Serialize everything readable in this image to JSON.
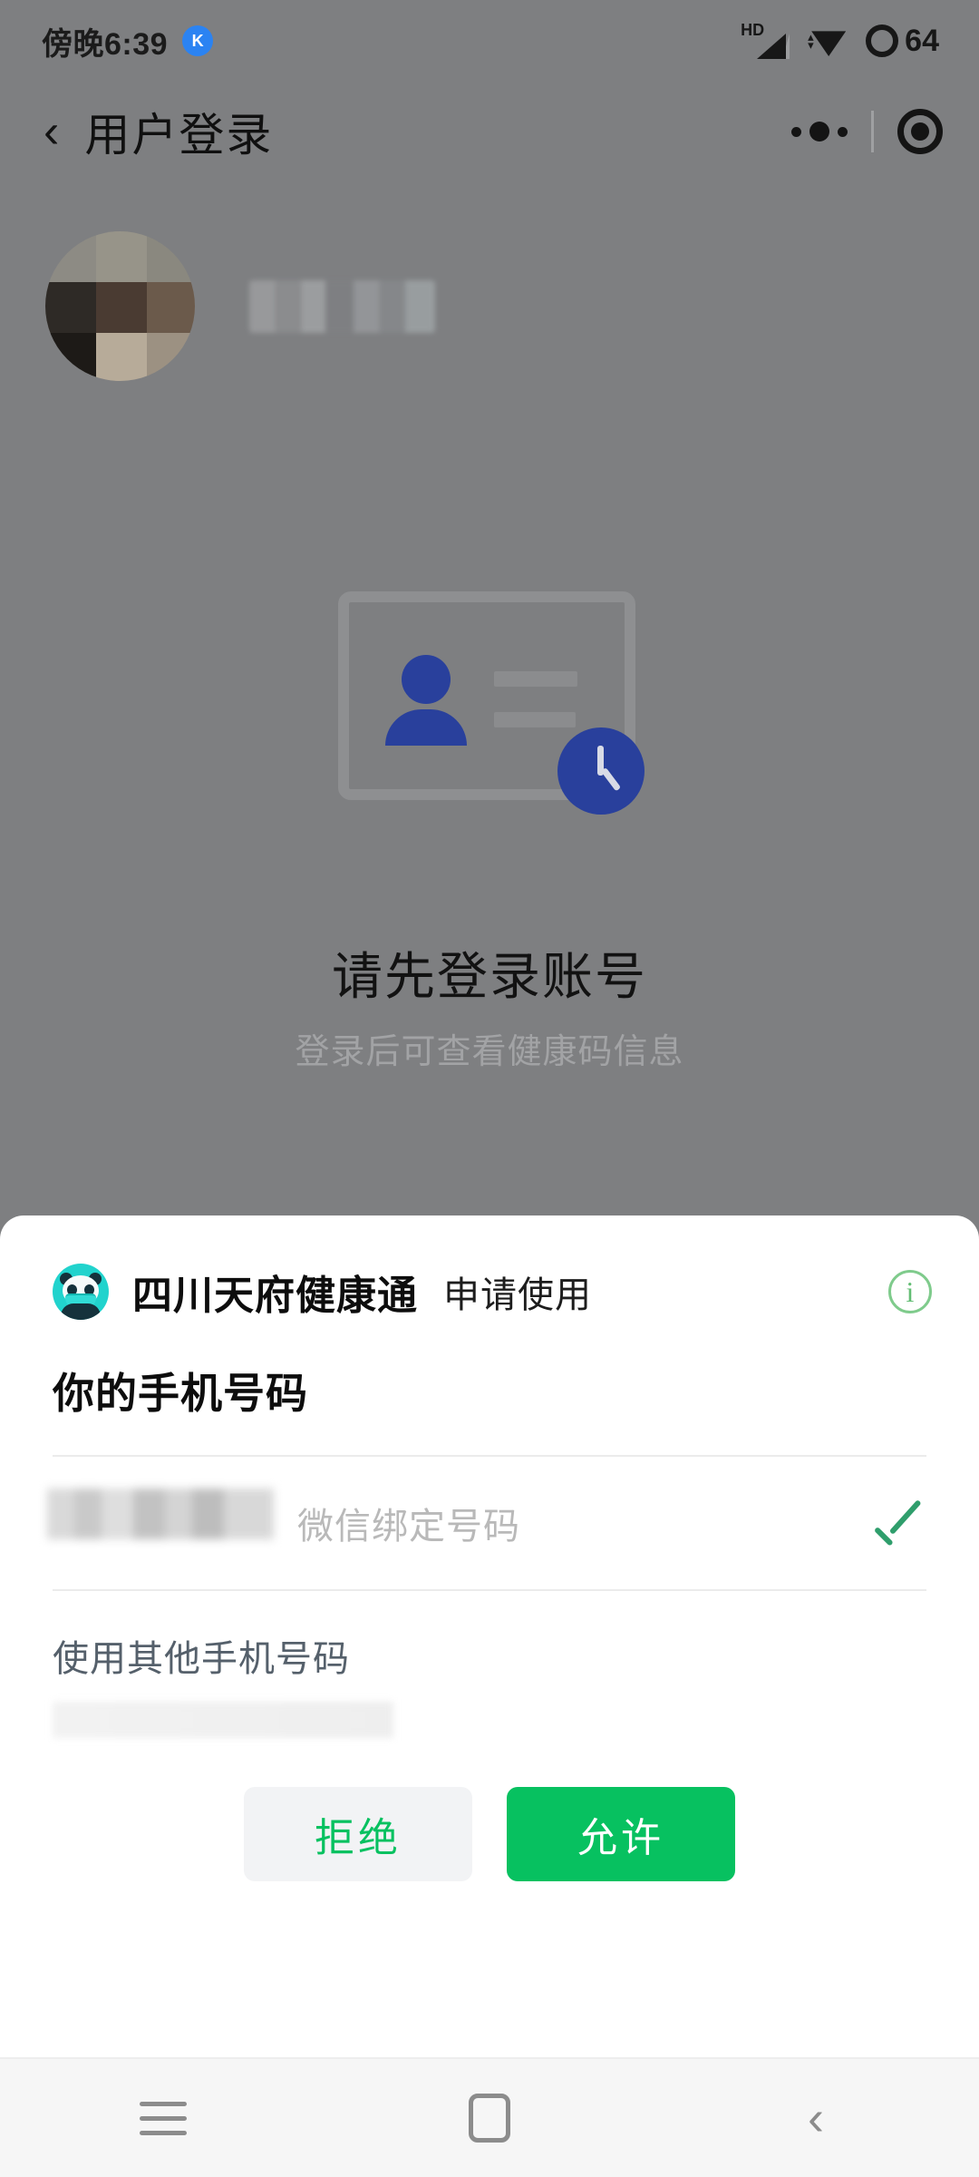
{
  "statusbar": {
    "time": "傍晚6:39",
    "app_badge": "K",
    "signal_label": "HD",
    "battery_level": "64",
    "icons": [
      "hd-signal-icon",
      "wifi-icon",
      "battery-icon"
    ]
  },
  "navbar": {
    "back_icon": "‹",
    "title": "用户登录",
    "capsule": {
      "menu_icon": "more-dots-icon",
      "target_icon": "target-icon"
    }
  },
  "profile": {
    "avatar_label": "用户头像",
    "username_redacted": "",
    "redacted": true
  },
  "empty_state": {
    "illustration": "id-card-clock-icon",
    "title": "请先登录账号",
    "subtitle": "登录后可查看健康码信息",
    "card_border_color": "#8e8f91",
    "accent_color": "#29409c"
  },
  "sheet": {
    "app_logo": "panda-logo-icon",
    "app_name": "四川天府健康通",
    "action_text": "申请使用",
    "info_icon": "info-icon",
    "scope_title": "你的手机号码",
    "phone": {
      "number_redacted": "",
      "label": "微信绑定号码",
      "selected": true,
      "check_icon": "check-icon",
      "check_color": "#2f9e6c"
    },
    "other_option": "使用其他手机号码",
    "buttons": {
      "deny": "拒绝",
      "allow": "允许"
    },
    "colors": {
      "brand_green": "#07c160",
      "deny_bg": "#f2f3f5",
      "info_green": "#63bd74"
    }
  },
  "androidnav": {
    "recents_icon": "menu-icon",
    "home_icon": "home-square-icon",
    "back_icon": "‹"
  }
}
